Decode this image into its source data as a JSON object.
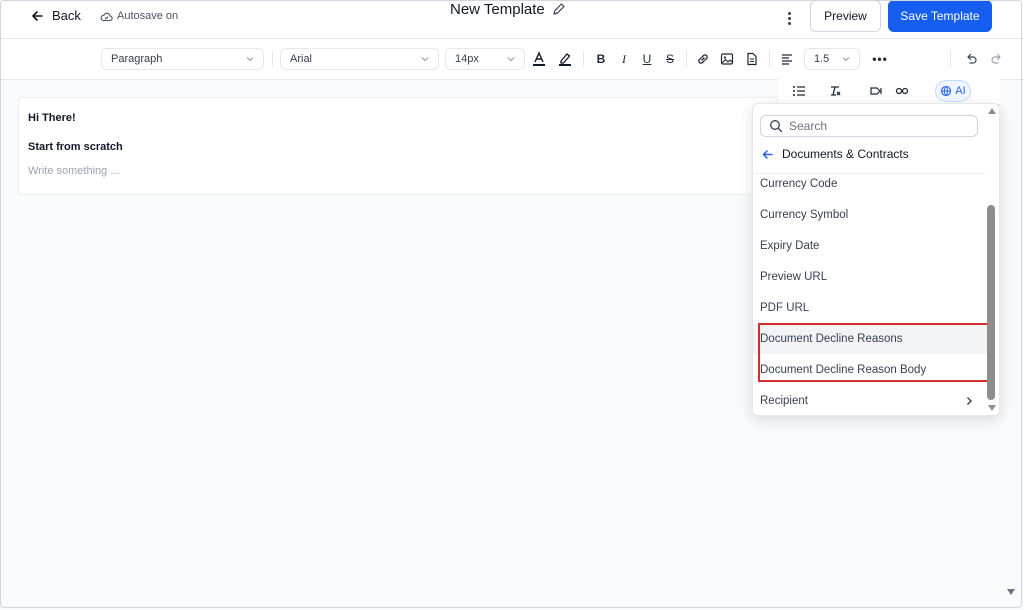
{
  "header": {
    "back_label": "Back",
    "autosave_label": "Autosave on",
    "title": "New Template",
    "preview_label": "Preview",
    "save_label": "Save Template"
  },
  "toolbar": {
    "block_type": "Paragraph",
    "font_family": "Arial",
    "font_size": "14px",
    "line_height": "1.5"
  },
  "ai_label": "AI",
  "editor": {
    "line1": "Hi There!",
    "line2": "Start from scratch",
    "placeholder": "Write something ..."
  },
  "dropdown": {
    "search_placeholder": "Search",
    "breadcrumb": "Documents & Contracts",
    "items": [
      "Currency Code",
      "Currency Symbol",
      "Expiry Date",
      "Preview URL",
      "PDF URL",
      "Document Decline Reasons",
      "Document Decline Reason Body",
      "Recipient"
    ]
  },
  "colors": {
    "accent": "#155eef",
    "highlight_box": "#d32f2f"
  }
}
